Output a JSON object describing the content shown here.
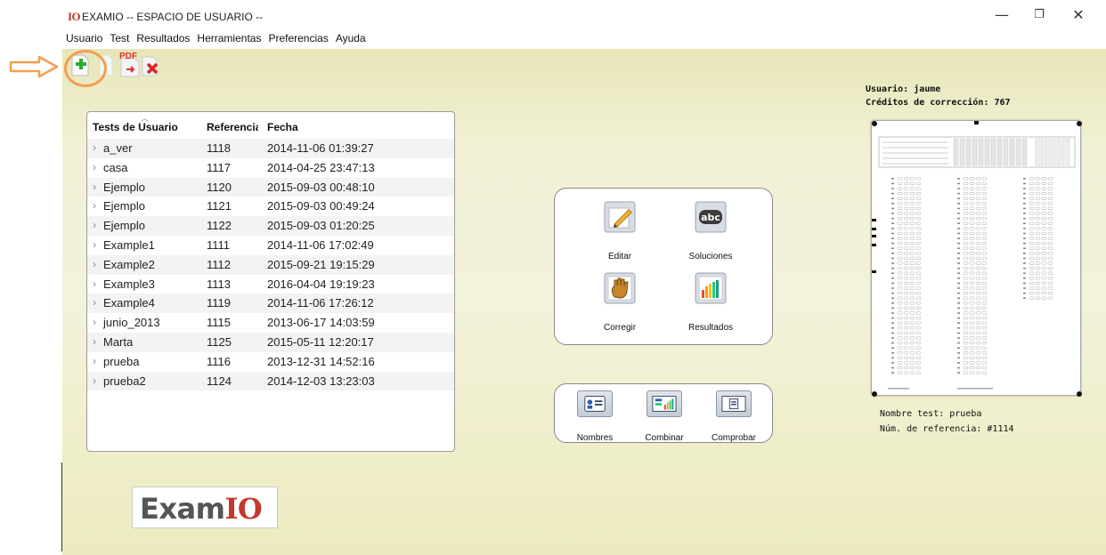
{
  "window": {
    "logo": "IO",
    "title": "EXAMIO -- ESPACIO DE USUARIO --",
    "minimize": "—",
    "maximize": "❐",
    "close": "✕"
  },
  "menu": [
    "Usuario",
    "Test",
    "Resultados",
    "Herramientas",
    "Preferencias",
    "Ayuda"
  ],
  "toolbar": {
    "new_icon": "add-test-icon",
    "pdf_label": "PDF",
    "pdf_icon": "export-pdf-icon",
    "delete_icon": "delete-icon",
    "highlight_color": "#f0a050"
  },
  "tests": {
    "headers": {
      "name": "Tests de Usuario",
      "ref": "Referencia",
      "date": "Fecha"
    },
    "rows": [
      {
        "name": "a_ver",
        "ref": "1118",
        "date": "2014-11-06 01:39:27"
      },
      {
        "name": "casa",
        "ref": "1117",
        "date": "2014-04-25 23:47:13"
      },
      {
        "name": "Ejemplo",
        "ref": "1120",
        "date": "2015-09-03 00:48:10"
      },
      {
        "name": "Ejemplo",
        "ref": "1121",
        "date": "2015-09-03 00:49:24"
      },
      {
        "name": "Ejemplo",
        "ref": "1122",
        "date": "2015-09-03 01:20:25"
      },
      {
        "name": "Example1",
        "ref": "1111",
        "date": "2014-11-06 17:02:49"
      },
      {
        "name": "Example2",
        "ref": "1112",
        "date": "2015-09-21 19:15:29"
      },
      {
        "name": "Example3",
        "ref": "1113",
        "date": "2016-04-04 19:19:23"
      },
      {
        "name": "Example4",
        "ref": "1119",
        "date": "2014-11-06 17:26:12"
      },
      {
        "name": "junio_2013",
        "ref": "1115",
        "date": "2013-06-17 14:03:59"
      },
      {
        "name": "Marta",
        "ref": "1125",
        "date": "2015-05-11 12:20:17"
      },
      {
        "name": "prueba",
        "ref": "1116",
        "date": "2013-12-31 14:52:16"
      },
      {
        "name": "prueba2",
        "ref": "1124",
        "date": "2014-12-03 13:23:03"
      }
    ]
  },
  "actions": {
    "edit": "Editar",
    "solutions": "Soluciones",
    "solutions_icon_text": "abc",
    "grade": "Corregir",
    "results": "Resultados"
  },
  "secondary_actions": {
    "names": "Nombres",
    "combine": "Combinar",
    "check": "Comprobar"
  },
  "user": {
    "user_line": "Usuario: jaume",
    "credits_line": "Créditos de corrección: 767"
  },
  "selected_test": {
    "name_line": "Nombre test: prueba",
    "ref_line": "Núm. de referencia: #1114"
  },
  "brand": {
    "exam": "Exam",
    "io": "IO"
  }
}
